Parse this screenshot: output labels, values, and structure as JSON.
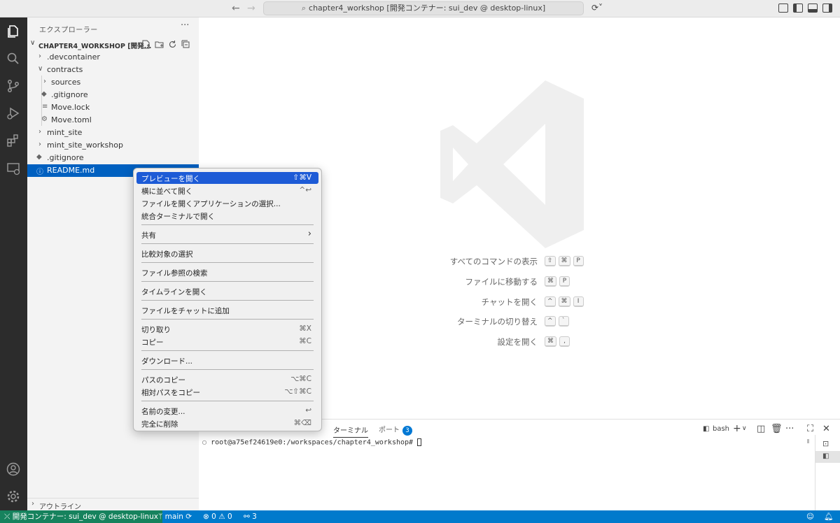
{
  "titlebar": {
    "search_text": "chapter4_workshop [開発コンテナー: sui_dev @ desktop-linux]"
  },
  "sidebar": {
    "title": "エクスプローラー",
    "workspace": "CHAPTER4_WORKSHOP [開発...",
    "tree": [
      {
        "label": ".devcontainer",
        "kind": "folder-collapsed"
      },
      {
        "label": "contracts",
        "kind": "folder-expanded"
      },
      {
        "label": "sources",
        "kind": "folder-collapsed"
      },
      {
        "label": ".gitignore",
        "kind": "git-file"
      },
      {
        "label": "Move.lock",
        "kind": "text-file"
      },
      {
        "label": "Move.toml",
        "kind": "settings-file"
      },
      {
        "label": "mint_site",
        "kind": "folder-collapsed"
      },
      {
        "label": "mint_site_workshop",
        "kind": "folder-collapsed"
      },
      {
        "label": ".gitignore",
        "kind": "git-file"
      },
      {
        "label": "README.md",
        "kind": "info-file",
        "selected": true
      }
    ],
    "outline": "アウトライン"
  },
  "editor": {
    "shortcuts": [
      {
        "label": "すべてのコマンドの表示",
        "keys": [
          "⇧",
          "⌘",
          "P"
        ]
      },
      {
        "label": "ファイルに移動する",
        "keys": [
          "⌘",
          "P"
        ]
      },
      {
        "label": "チャットを開く",
        "keys": [
          "^",
          "⌘",
          "I"
        ]
      },
      {
        "label": "ターミナルの切り替え",
        "keys": [
          "^",
          "`"
        ]
      },
      {
        "label": "設定を開く",
        "keys": [
          "⌘",
          ","
        ]
      }
    ]
  },
  "panel": {
    "tabs": [
      {
        "label": "ターミナル",
        "active": true
      },
      {
        "label": "ポート",
        "badge": "3"
      }
    ],
    "shell": "bash",
    "terminal_line": "root@a75ef24619e0:/workspaces/chapter4_workshop# "
  },
  "context_menu": {
    "items": [
      {
        "label": "プレビューを開く",
        "shortcut": "⇧⌘V",
        "highlighted": true
      },
      {
        "label": "横に並べて開く",
        "shortcut": "^↩"
      },
      {
        "label": "ファイルを開くアプリケーションの選択...",
        "shortcut": ""
      },
      {
        "label": "統合ターミナルで開く",
        "shortcut": ""
      },
      {
        "label": "共有",
        "shortcut": "›"
      },
      {
        "label": "比較対象の選択",
        "shortcut": ""
      },
      {
        "label": "ファイル参照の検索",
        "shortcut": ""
      },
      {
        "label": "タイムラインを開く",
        "shortcut": ""
      },
      {
        "label": "ファイルをチャットに追加",
        "shortcut": ""
      },
      {
        "label": "切り取り",
        "shortcut": "⌘X"
      },
      {
        "label": "コピー",
        "shortcut": "⌘C"
      },
      {
        "label": "ダウンロード...",
        "shortcut": ""
      },
      {
        "label": "パスのコピー",
        "shortcut": "⌥⌘C"
      },
      {
        "label": "相対パスをコピー",
        "shortcut": "⌥⇧⌘C"
      },
      {
        "label": "名前の変更...",
        "shortcut": "↩"
      },
      {
        "label": "完全に削除",
        "shortcut": "⌘⌫"
      }
    ]
  },
  "statusbar": {
    "remote": "開発コンテナー: sui_dev @ desktop-linux",
    "branch": "main",
    "problems": "0",
    "warnings": "0",
    "ports": "3"
  },
  "colors": {
    "accent": "#007acc",
    "remote": "#16825d",
    "selection": "#0060c0",
    "menu_highlight": "#1d5bd6"
  }
}
